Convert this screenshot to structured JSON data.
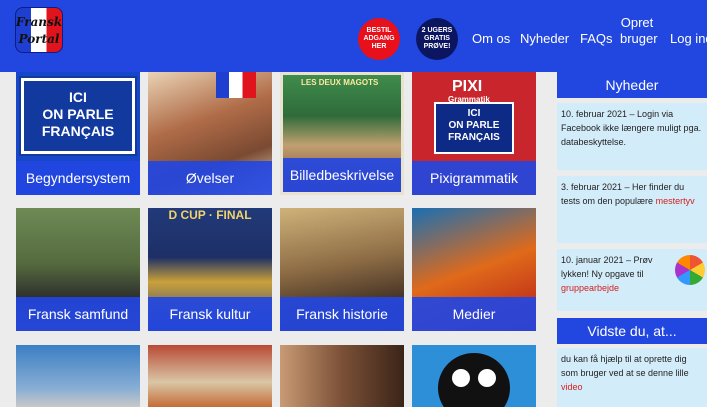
{
  "header": {
    "logo_line1": "Fransk",
    "logo_line2": "Portal",
    "badge_order": "BESTIL ADGANG HER",
    "badge_trial": "2 UGERS GRATIS PRØVE!",
    "nav": [
      "Om os",
      "Nyheder",
      "FAQs",
      "Opret",
      "bruger",
      "Log ind"
    ]
  },
  "tiles": [
    {
      "label": "Begyndersystem",
      "sign": [
        "ICI",
        "ON PARLE",
        "FRANÇAIS"
      ]
    },
    {
      "label": "Øvelser"
    },
    {
      "label": "Billedbeskrivelse",
      "sign_text": "LES DEUX MAGOTS"
    },
    {
      "label": "Pixigrammatik",
      "title": "PIXI",
      "subtitle": "Grammatik",
      "sign": [
        "ICI",
        "ON PARLE",
        "FRANÇAIS"
      ]
    },
    {
      "label": "Fransk samfund"
    },
    {
      "label": "Fransk kultur",
      "overlay": "D CUP · FINAL"
    },
    {
      "label": "Fransk historie"
    },
    {
      "label": "Medier"
    },
    {
      "label": ""
    },
    {
      "label": ""
    },
    {
      "label": ""
    },
    {
      "label": ""
    }
  ],
  "sidebar": {
    "news_title": "Nyheder",
    "news": [
      {
        "text": "10. februar 2021 – Login via Facebook ikke længere muligt pga. databeskyttelse.",
        "link": ""
      },
      {
        "text": "3. februar 2021 – Her finder du tests om den populære",
        "link": "mestertyv"
      },
      {
        "text": "10. januar 2021 – Prøv lykken! Ny opgave til",
        "link": "gruppearbejde"
      }
    ],
    "did_you_know_title": "Vidste du, at...",
    "did_you_know": {
      "text": "du kan få hjælp til at oprette dig som bruger ved at se denne lille",
      "link": "video"
    }
  },
  "colors": {
    "brand_blue": "#2247e0",
    "link_red": "#d42020",
    "news_bg": "#d3ecf9"
  }
}
